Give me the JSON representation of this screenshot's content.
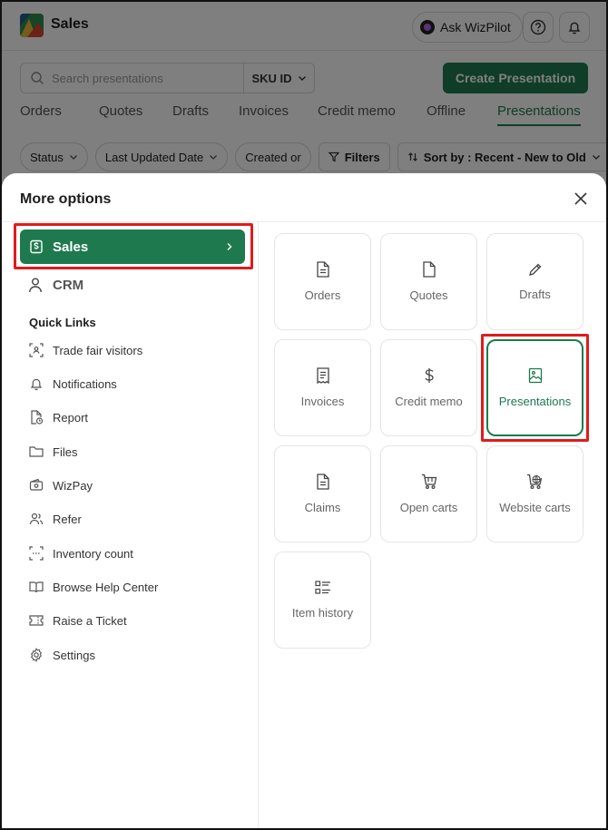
{
  "app": {
    "title": "Sales",
    "ask_wizpilot": "Ask WizPilot",
    "search_placeholder": "Search presentations",
    "search_scope": "SKU ID",
    "create_button": "Create Presentation",
    "tabs": [
      "Orders",
      "Quotes",
      "Drafts",
      "Invoices",
      "Credit memo",
      "Offline",
      "Presentations"
    ],
    "active_tab": "Presentations",
    "filters": {
      "status": "Status",
      "last_updated": "Last Updated Date",
      "created_on": "Created or",
      "filters_btn": "Filters",
      "sort": "Sort by : Recent - New to Old"
    }
  },
  "modal": {
    "title": "More options",
    "sidebar": {
      "sales_label": "Sales",
      "crm_label": "CRM",
      "quick_links_title": "Quick Links",
      "quick_links": [
        {
          "label": "Trade fair visitors",
          "icon": "scan-user-icon"
        },
        {
          "label": "Notifications",
          "icon": "bell-icon"
        },
        {
          "label": "Report",
          "icon": "report-icon"
        },
        {
          "label": "Files",
          "icon": "folder-icon"
        },
        {
          "label": "WizPay",
          "icon": "wallet-icon"
        },
        {
          "label": "Refer",
          "icon": "users-icon"
        },
        {
          "label": "Inventory count",
          "icon": "scan-icon"
        },
        {
          "label": "Browse Help Center",
          "icon": "book-icon"
        },
        {
          "label": "Raise a Ticket",
          "icon": "ticket-icon"
        },
        {
          "label": "Settings",
          "icon": "gear-icon"
        }
      ]
    },
    "cards": [
      {
        "label": "Orders",
        "icon": "document-lines-icon"
      },
      {
        "label": "Quotes",
        "icon": "document-icon"
      },
      {
        "label": "Drafts",
        "icon": "pencil-icon"
      },
      {
        "label": "Invoices",
        "icon": "receipt-icon"
      },
      {
        "label": "Credit memo",
        "icon": "dollar-icon"
      },
      {
        "label": "Presentations",
        "icon": "image-icon"
      },
      {
        "label": "Claims",
        "icon": "document-lines-icon"
      },
      {
        "label": "Open carts",
        "icon": "cart-icon"
      },
      {
        "label": "Website carts",
        "icon": "globe-cart-icon"
      },
      {
        "label": "Item history",
        "icon": "list-icon"
      }
    ],
    "active_card": "Presentations"
  },
  "colors": {
    "brand_green": "#1e7a4e",
    "highlight_red": "#e11b1b"
  }
}
